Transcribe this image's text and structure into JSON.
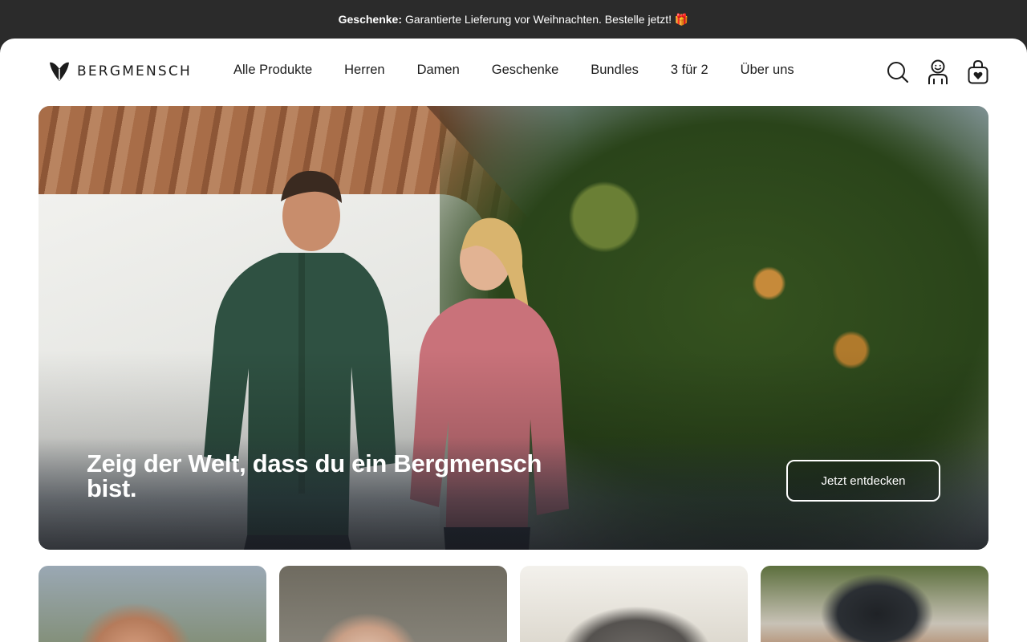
{
  "announcement": {
    "bold": "Geschenke:",
    "text": "Garantierte Lieferung vor Weihnachten. Bestelle jetzt! 🎁"
  },
  "brand": {
    "name": "BERGMENSCH"
  },
  "nav": {
    "items": [
      "Alle Produkte",
      "Herren",
      "Damen",
      "Geschenke",
      "Bundles",
      "3 für 2",
      "Über uns"
    ]
  },
  "header_icons": [
    "search-icon",
    "account-icon",
    "cart-icon"
  ],
  "hero": {
    "title": "Zeig der Welt, dass du ein Bergmensch bist.",
    "cta": "Jetzt entdecken"
  },
  "colors": {
    "announcement_bg": "#2b2b2b",
    "text": "#1c1c1c",
    "white": "#ffffff"
  }
}
